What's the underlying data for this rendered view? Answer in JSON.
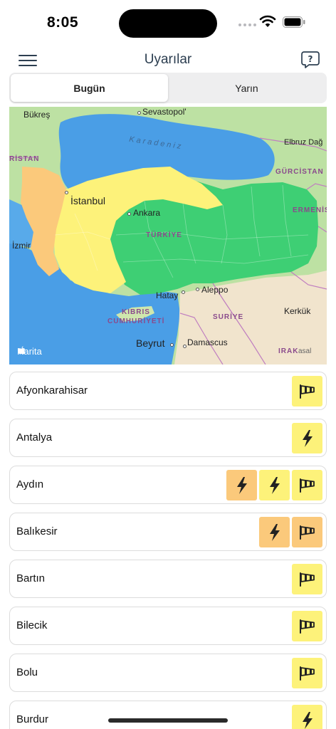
{
  "status_bar": {
    "time": "8:05"
  },
  "nav": {
    "title": "Uyarılar"
  },
  "tabs": [
    {
      "label": "Bugün",
      "active": true
    },
    {
      "label": "Yarın",
      "active": false
    }
  ],
  "map": {
    "labels": {
      "bukres": "Bükreş",
      "sevastopol": "Sevastopol'",
      "karadeniz": "Karadeniz",
      "elbruz": "Elbruz Dağ",
      "ristan": "RİSTAN",
      "gurcistan": "GÜRCİSTAN",
      "istanbul": "İstanbul",
      "ermenistan": "ERMENİS",
      "ankara": "Ankara",
      "izmir": "İzmir",
      "turkiye": "TÜRKİYE",
      "hatay": "Hatay",
      "aleppo": "Aleppo",
      "kibris1": "KIBRIS",
      "kibris2": "CUMHURİYETİ",
      "suriye": "SURİYE",
      "kerkuk": "Kerkük",
      "beyrut": "Beyrut",
      "damascus": "Damascus",
      "irak": "IRAK",
      "basel": "asal",
      "attribution": "Harita"
    }
  },
  "colors": {
    "warning_yellow": "#fdf27a",
    "warning_orange": "#fbc97b",
    "no_warning_green": "#3ecf74"
  },
  "provinces": [
    {
      "name": "Afyonkarahisar",
      "badges": [
        {
          "icon": "wind-icon",
          "level": "yellow"
        }
      ]
    },
    {
      "name": "Antalya",
      "badges": [
        {
          "icon": "lightning-icon",
          "level": "yellow"
        }
      ]
    },
    {
      "name": "Aydın",
      "badges": [
        {
          "icon": "lightning-icon",
          "level": "orange"
        },
        {
          "icon": "lightning-icon",
          "level": "yellow"
        },
        {
          "icon": "wind-icon",
          "level": "yellow"
        }
      ]
    },
    {
      "name": "Balıkesir",
      "badges": [
        {
          "icon": "lightning-icon",
          "level": "orange"
        },
        {
          "icon": "wind-icon",
          "level": "orange"
        }
      ]
    },
    {
      "name": "Bartın",
      "badges": [
        {
          "icon": "wind-icon",
          "level": "yellow"
        }
      ]
    },
    {
      "name": "Bilecik",
      "badges": [
        {
          "icon": "wind-icon",
          "level": "yellow"
        }
      ]
    },
    {
      "name": "Bolu",
      "badges": [
        {
          "icon": "wind-icon",
          "level": "yellow"
        }
      ]
    },
    {
      "name": "Burdur",
      "badges": [
        {
          "icon": "lightning-icon",
          "level": "yellow"
        }
      ]
    }
  ]
}
